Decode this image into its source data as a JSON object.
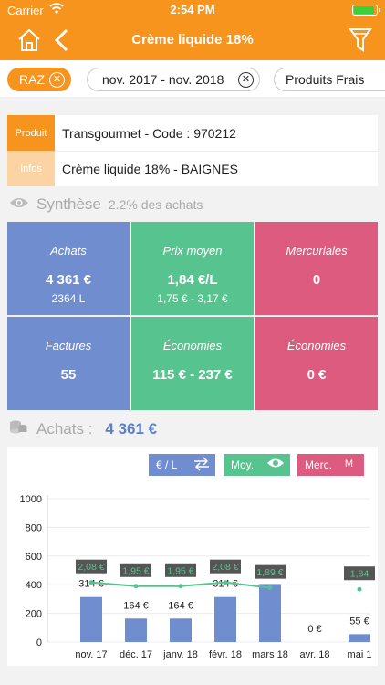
{
  "status": {
    "carrier": "Carrier",
    "time": "2:54 PM"
  },
  "nav": {
    "title": "Crème liquide 18%"
  },
  "filters": {
    "raz": "RAZ",
    "period": "nov. 2017 - nov. 2018",
    "category": "Produits Frais"
  },
  "info": {
    "produit_label": "Produit",
    "produit_value": "Transgourmet - Code : 970212",
    "infos_label": "Infos",
    "infos_value": "Crème liquide 18% - BAIGNES"
  },
  "synthese": {
    "title": "Synthèse",
    "subtitle": "2.2% des achats"
  },
  "tiles": {
    "achats": {
      "title": "Achats",
      "value": "4 361 €",
      "sub": "2364 L"
    },
    "prix": {
      "title": "Prix moyen",
      "value": "1,84 €/L",
      "sub": "1,75 € - 3,17 €"
    },
    "mercuriales": {
      "title": "Mercuriales",
      "value": "0"
    },
    "factures": {
      "title": "Factures",
      "value": "55"
    },
    "economies1": {
      "title": "Économies",
      "value": "115 € - 237 €"
    },
    "economies2": {
      "title": "Économies",
      "value": "0 €"
    }
  },
  "achats_section": {
    "title": "Achats :",
    "value": "4 361 €"
  },
  "chart_buttons": {
    "unit": "€ / L",
    "moy": "Moy.",
    "merc": "Merc.",
    "merc_icon": "M"
  },
  "colors": {
    "orange": "#f7941d",
    "blue": "#6f8dcf",
    "green": "#57c48f",
    "pink": "#de5b80"
  },
  "chart_data": {
    "type": "bar",
    "categories": [
      "nov. 17",
      "déc. 17",
      "janv. 18",
      "févr. 18",
      "mars 18",
      "avr. 18",
      "mai 1"
    ],
    "series": [
      {
        "values": [
          314,
          164,
          164,
          314,
          405,
          0,
          55
        ],
        "labels": [
          "314 €",
          "164 €",
          "164 €",
          "314 €",
          "405 €",
          "0 €",
          "55 €"
        ]
      }
    ],
    "avg_price": {
      "values": [
        2.08,
        1.95,
        1.95,
        2.08,
        1.89,
        null,
        1.84
      ],
      "labels": [
        "2,08 €",
        "1,95 €",
        "1,95 €",
        "2,08 €",
        "1,89 €",
        null,
        "1,84"
      ]
    },
    "yticks": [
      "1000",
      "800",
      "600",
      "400",
      "200",
      "0"
    ],
    "ylim": [
      0,
      1000
    ],
    "grid": true
  }
}
